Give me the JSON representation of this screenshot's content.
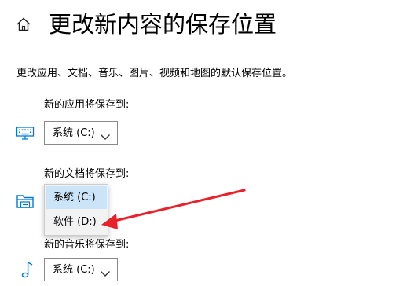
{
  "header": {
    "title": "更改新内容的保存位置",
    "home_icon": "home-icon"
  },
  "description": "更改应用、文档、音乐、图片、视频和地图的默认保存位置。",
  "sections": {
    "apps": {
      "label": "新的应用将保存到:",
      "value": "系统 (C:)",
      "icon": "keyboard-icon"
    },
    "documents": {
      "label": "新的文档将保存到:",
      "icon": "folder-icon",
      "options": [
        "系统 (C:)",
        "软件 (D:)"
      ],
      "highlighted_option": "系统 (C:)"
    },
    "music": {
      "label": "新的音乐将保存到:",
      "value": "系统 (C:)",
      "icon": "music-note-icon"
    }
  },
  "colors": {
    "accent": "#0078d7",
    "selection": "#cce4f7",
    "annotation_arrow": "#e8222b"
  }
}
